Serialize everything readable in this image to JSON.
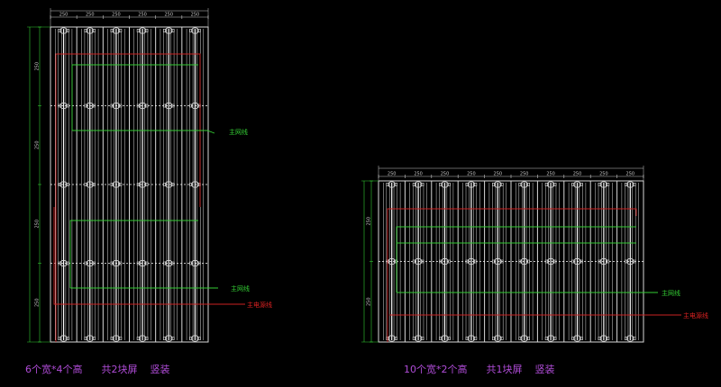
{
  "colors": {
    "background": "#000000",
    "panel": "#d8d8d8",
    "dimension": "#c8c8c8",
    "network_line": "#33cc33",
    "power_line": "#cc2222",
    "caption": "#b04cd8",
    "network_label": "#33cc33",
    "power_label": "#dd2222"
  },
  "panels": [
    {
      "id": "left",
      "caption_text": "6个宽*4个高      共2块屏    竖装",
      "columns": 6,
      "rows": 4,
      "network_label": "主网线",
      "power_label": "主电源线",
      "top_dims": [
        "250",
        "250",
        "250",
        "250",
        "250",
        "250"
      ],
      "side_dims": [
        "250",
        "250",
        "250",
        "250"
      ]
    },
    {
      "id": "right",
      "caption_text": "10个宽*2个高      共1块屏    竖装",
      "columns": 10,
      "rows": 2,
      "network_label": "主网线",
      "power_label": "主电源线",
      "top_dims": [
        "250",
        "250",
        "250",
        "250",
        "250",
        "250",
        "250",
        "250",
        "250",
        "250"
      ],
      "side_dims": [
        "250",
        "250"
      ]
    }
  ]
}
